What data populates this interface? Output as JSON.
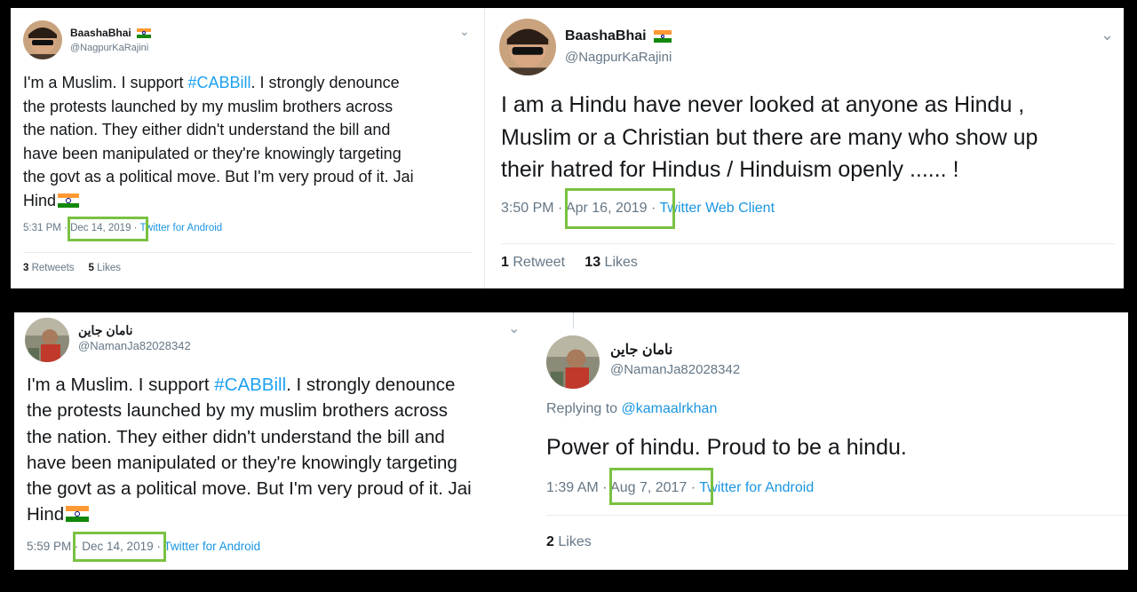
{
  "tweets": [
    {
      "name": "BaashaBhai",
      "handle": "@NagpurKaRajini",
      "body_lines": [
        "I'm a Muslim. I support ",
        "the protests launched by my muslim brothers across",
        "the nation. They either didn't understand the bill and",
        "have been manipulated or they're knowingly targeting",
        "the govt as a political move. But I'm very proud of it. Jai",
        "Hind"
      ],
      "hashtag": "#CABBill",
      "after_hashtag": ". I strongly denounce",
      "time": "5:31 PM",
      "date": "Dec 14, 2019",
      "source": "Twitter for Android",
      "retweets_count": "3",
      "retweets_label": "Retweets",
      "likes_count": "5",
      "likes_label": "Likes"
    },
    {
      "name": "BaashaBhai",
      "handle": "@NagpurKaRajini",
      "body_lines": [
        "I am a Hindu have never looked at anyone as Hindu ,",
        "Muslim or a Christian but there are many who show up",
        "their hatred for Hindus / Hinduism openly ...... !"
      ],
      "time": "3:50 PM",
      "date": "Apr 16, 2019",
      "source": "Twitter Web Client",
      "retweets_count": "1",
      "retweets_label": "Retweet",
      "likes_count": "13",
      "likes_label": "Likes"
    },
    {
      "name": "نامان جاین",
      "handle": "@NamanJa82028342",
      "body_lines": [
        "I'm a Muslim. I support ",
        "the protests launched by my muslim brothers across",
        "the nation. They either didn't understand the bill and",
        "have been manipulated or they're knowingly targeting",
        "the govt as a political move. But I'm very proud of it. Jai",
        "Hind"
      ],
      "hashtag": "#CABBill",
      "after_hashtag": ". I strongly denounce",
      "time": "5:59 PM",
      "date": "Dec 14, 2019",
      "source": "Twitter for Android"
    },
    {
      "name": "نامان جاین",
      "handle": "@NamanJa82028342",
      "replying_label": "Replying to",
      "replying_to": "@kamaalrkhan",
      "body_lines": [
        "Power of hindu. Proud to be a hindu."
      ],
      "time": "1:39 AM",
      "date": "Aug 7, 2017",
      "source": "Twitter for Android",
      "likes_count": "2",
      "likes_label": "Likes"
    }
  ],
  "icons": {
    "menu": "chevron-down-icon",
    "flag": "india-flag-icon",
    "highlight_color": "#7ac142"
  }
}
